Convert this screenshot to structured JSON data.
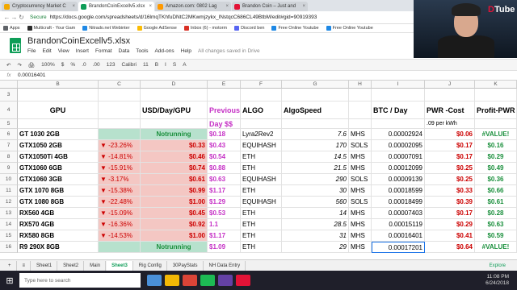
{
  "browser": {
    "tabs": [
      {
        "label": "Cryptocurrency Market C",
        "color": "#f2a900"
      },
      {
        "label": "BrandonCoinExcellv5.xlsx",
        "color": "#0f9d58"
      },
      {
        "label": "Amazon.com: 0802 Lag",
        "color": "#ff9900"
      },
      {
        "label": "Brandon Coin – Just and",
        "color": "#e31337"
      }
    ],
    "secure": "Secure",
    "url": "https://docs.google.com/spreadsheets/d/16lmqTKhfuDNtC2MKwmjzykx_lNstqcC686CL49BtbM/edit#gid=90919393",
    "bookmarks": [
      {
        "label": "Apps",
        "color": "#5f6368"
      },
      {
        "label": "Multicraft - Your Gam",
        "color": "#2b2b2b"
      },
      {
        "label": "Nitrado.net Webinter",
        "color": "#1e88e5"
      },
      {
        "label": "Google AdSense",
        "color": "#fbbc04"
      },
      {
        "label": "Inbox (6) - motorm",
        "color": "#d93025"
      },
      {
        "label": "Discord ben",
        "color": "#5865f2"
      },
      {
        "label": "Free Online Youtube",
        "color": "#1e88e5"
      },
      {
        "label": "Free Online Youtube",
        "color": "#1e88e5"
      }
    ]
  },
  "doc": {
    "title": "BrandonCoinExcellv5.xlsx",
    "menu": [
      "File",
      "Edit",
      "View",
      "Insert",
      "Format",
      "Data",
      "Tools",
      "Add-ons",
      "Help"
    ],
    "saved": "All changes saved in Drive",
    "toolbar": [
      "↶",
      "↷",
      "🖨",
      "100%",
      "$",
      "%",
      ".0",
      ".00",
      "123",
      "Calibri",
      "11",
      "B",
      "I",
      "S",
      "A"
    ],
    "formula": "0.00016401"
  },
  "columns": [
    "",
    "B",
    "C",
    "D",
    "E",
    "F",
    "G",
    "H",
    "I",
    "J",
    "K"
  ],
  "rows": [
    {
      "num": "3",
      "cells": [
        "",
        "",
        "",
        "",
        "",
        "",
        "",
        "",
        "",
        ""
      ]
    },
    {
      "num": "4",
      "cells": [
        "GPU",
        "",
        "USD/Day/GPU",
        "Previous",
        "ALGO",
        "AlgoSpeed",
        "",
        "BTC / Day",
        "PWR -Cost",
        "Profit-PWR"
      ]
    },
    {
      "num": "5",
      "cells": [
        "",
        "",
        "",
        "Day $$",
        "",
        "",
        "",
        "",
        ".09 per kWh",
        ""
      ]
    },
    {
      "num": "6",
      "cells": [
        "GT 1030    2GB",
        "",
        "Notrunning",
        "$0.18",
        "Lyra2Rev2",
        "7.6",
        "MHS",
        "0.00002924",
        "$0.06",
        "#VALUE!"
      ]
    },
    {
      "num": "7",
      "cells": [
        "GTX1050     2GB",
        "▼ -23.26%",
        "$0.33",
        "$0.43",
        "EQUIHASH",
        "170",
        "SOLS",
        "0.00002095",
        "$0.17",
        "$0.16"
      ]
    },
    {
      "num": "8",
      "cells": [
        "GTX1050Ti  4GB",
        "▼ -14.81%",
        "$0.46",
        "$0.54",
        "ETH",
        "14.5",
        "MHS",
        "0.00007091",
        "$0.17",
        "$0.29"
      ]
    },
    {
      "num": "9",
      "cells": [
        "GTX1060    6GB",
        "▼ -15.91%",
        "$0.74",
        "$0.88",
        "ETH",
        "21.5",
        "MHS",
        "0.00012099",
        "$0.25",
        "$0.49"
      ]
    },
    {
      "num": "10",
      "cells": [
        "GTX1060    3GB",
        "▼ -3.17%",
        "$0.61",
        "$0.63",
        "EQUIHASH",
        "290",
        "SOLS",
        "0.00009139",
        "$0.25",
        "$0.36"
      ]
    },
    {
      "num": "11",
      "cells": [
        "GTX 1070   8GB",
        "▼ -15.38%",
        "$0.99",
        "$1.17",
        "ETH",
        "30",
        "MHS",
        "0.00018599",
        "$0.33",
        "$0.66"
      ]
    },
    {
      "num": "12",
      "cells": [
        "GTX 1080   8GB",
        "▼ -22.48%",
        "$1.00",
        "$1.29",
        "EQUIHASH",
        "560",
        "SOLS",
        "0.00018499",
        "$0.39",
        "$0.61"
      ]
    },
    {
      "num": "13",
      "cells": [
        "RX560   4GB",
        "▼ -15.09%",
        "$0.45",
        "$0.53",
        "ETH",
        "14",
        "MHS",
        "0.00007403",
        "$0.17",
        "$0.28"
      ]
    },
    {
      "num": "14",
      "cells": [
        "RX570   4GB",
        "▼ -16.36%",
        "$0.92",
        "1.1",
        "ETH",
        "28.5",
        "MHS",
        "0.00015119",
        "$0.29",
        "$0.63"
      ]
    },
    {
      "num": "15",
      "cells": [
        "RX580   8GB",
        "▼ -14.53%",
        "$1.00",
        "$1.17",
        "ETH",
        "31",
        "MHS",
        "0.00016401",
        "$0.41",
        "$0.59"
      ]
    },
    {
      "num": "16",
      "cells": [
        "R9 290X 8GB",
        "",
        "Notrunning",
        "$1.09",
        "ETH",
        "29",
        "MHS",
        "0.00017201",
        "$0.64",
        "#VALUE!"
      ]
    }
  ],
  "sheets": [
    "Sheet1",
    "Sheet2",
    "Main",
    "Sheet3",
    "Rig Config",
    "30PayStats",
    "NH Data Entry"
  ],
  "active_sheet": "Sheet3",
  "explore": "Explore",
  "taskbar": {
    "search": "Type here to search",
    "time": "11:08 PM",
    "date": "6/24/2018"
  },
  "stream": {
    "brand_d": "D",
    "brand_rest": "Tube"
  }
}
